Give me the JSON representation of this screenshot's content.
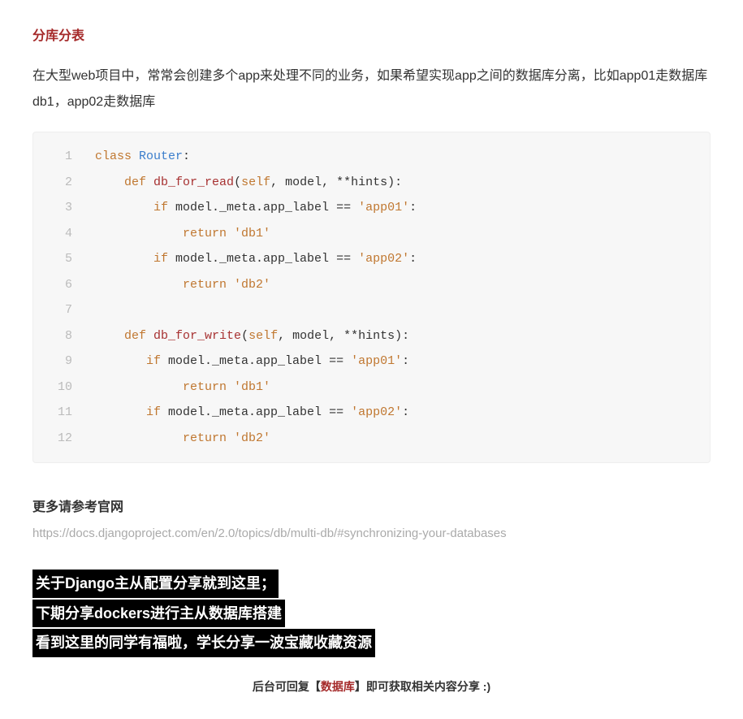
{
  "heading": "分库分表",
  "paragraph": "在大型web项目中，常常会创建多个app来处理不同的业务，如果希望实现app之间的数据库分离，比如app01走数据库db1，app02走数据库",
  "code": {
    "lines": [
      {
        "n": "1",
        "tokens": [
          {
            "t": "class ",
            "c": "tok-kw"
          },
          {
            "t": "Router",
            "c": "tok-cls"
          },
          {
            "t": ":",
            "c": "tok-punc"
          }
        ]
      },
      {
        "n": "2",
        "tokens": [
          {
            "t": "    ",
            "c": ""
          },
          {
            "t": "def ",
            "c": "tok-kw"
          },
          {
            "t": "db_for_read",
            "c": "tok-fn"
          },
          {
            "t": "(",
            "c": "tok-punc"
          },
          {
            "t": "self",
            "c": "tok-param"
          },
          {
            "t": ", model, **hints)",
            "c": "tok-ident"
          },
          {
            "t": ":",
            "c": "tok-punc"
          }
        ]
      },
      {
        "n": "3",
        "tokens": [
          {
            "t": "        ",
            "c": ""
          },
          {
            "t": "if ",
            "c": "tok-kw"
          },
          {
            "t": "model._meta.app_label == ",
            "c": "tok-ident"
          },
          {
            "t": "'app01'",
            "c": "tok-str"
          },
          {
            "t": ":",
            "c": "tok-punc"
          }
        ]
      },
      {
        "n": "4",
        "tokens": [
          {
            "t": "            ",
            "c": ""
          },
          {
            "t": "return ",
            "c": "tok-kw"
          },
          {
            "t": "'db1'",
            "c": "tok-str"
          }
        ]
      },
      {
        "n": "5",
        "tokens": [
          {
            "t": "        ",
            "c": ""
          },
          {
            "t": "if ",
            "c": "tok-kw"
          },
          {
            "t": "model._meta.app_label == ",
            "c": "tok-ident"
          },
          {
            "t": "'app02'",
            "c": "tok-str"
          },
          {
            "t": ":",
            "c": "tok-punc"
          }
        ]
      },
      {
        "n": "6",
        "tokens": [
          {
            "t": "            ",
            "c": ""
          },
          {
            "t": "return ",
            "c": "tok-kw"
          },
          {
            "t": "'db2'",
            "c": "tok-str"
          }
        ]
      },
      {
        "n": "7",
        "tokens": [
          {
            "t": "",
            "c": ""
          }
        ]
      },
      {
        "n": "8",
        "tokens": [
          {
            "t": "    ",
            "c": ""
          },
          {
            "t": "def ",
            "c": "tok-kw"
          },
          {
            "t": "db_for_write",
            "c": "tok-fn"
          },
          {
            "t": "(",
            "c": "tok-punc"
          },
          {
            "t": "self",
            "c": "tok-param"
          },
          {
            "t": ", model, **hints)",
            "c": "tok-ident"
          },
          {
            "t": ":",
            "c": "tok-punc"
          }
        ]
      },
      {
        "n": "9",
        "tokens": [
          {
            "t": "       ",
            "c": ""
          },
          {
            "t": "if ",
            "c": "tok-kw"
          },
          {
            "t": "model._meta.app_label == ",
            "c": "tok-ident"
          },
          {
            "t": "'app01'",
            "c": "tok-str"
          },
          {
            "t": ":",
            "c": "tok-punc"
          }
        ]
      },
      {
        "n": "10",
        "tokens": [
          {
            "t": "            ",
            "c": ""
          },
          {
            "t": "return ",
            "c": "tok-kw"
          },
          {
            "t": "'db1'",
            "c": "tok-str"
          }
        ]
      },
      {
        "n": "11",
        "tokens": [
          {
            "t": "       ",
            "c": ""
          },
          {
            "t": "if ",
            "c": "tok-kw"
          },
          {
            "t": "model._meta.app_label == ",
            "c": "tok-ident"
          },
          {
            "t": "'app02'",
            "c": "tok-str"
          },
          {
            "t": ":",
            "c": "tok-punc"
          }
        ]
      },
      {
        "n": "12",
        "tokens": [
          {
            "t": "            ",
            "c": ""
          },
          {
            "t": "return ",
            "c": "tok-kw"
          },
          {
            "t": "'db2'",
            "c": "tok-str"
          }
        ]
      }
    ]
  },
  "subheading": "更多请参考官网",
  "ref_url": "https://docs.djangoproject.com/en/2.0/topics/db/multi-db/#synchronizing-your-databases",
  "highlights": [
    "关于Django主从配置分享就到这里；",
    "下期分享dockers进行主从数据库搭建",
    "看到这里的同学有福啦，学长分享一波宝藏收藏资源"
  ],
  "footer": {
    "prefix": "后台可回复【",
    "keyword": "数据库",
    "suffix": "】即可获取相关内容分享 :)"
  }
}
